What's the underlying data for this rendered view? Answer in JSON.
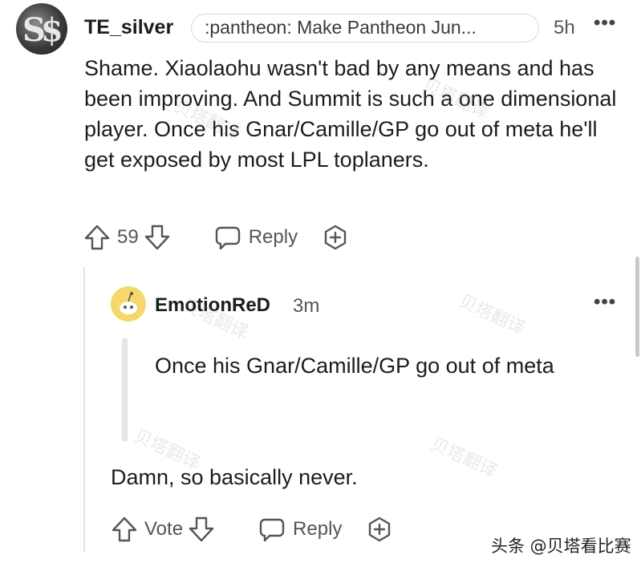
{
  "post_comment": {
    "username": "TE_silver",
    "flair": ":pantheon: Make Pantheon Jun...",
    "time": "5h",
    "more_icon": "more-dots-icon",
    "body": "Shame. Xiaolaohu wasn't bad by any means and has been improving. And Summit is such a one dimensional player. Once his Gnar/Camille/GP go out of meta he'll get exposed by most LPL toplaners.",
    "vote_count": "59",
    "reply_label": "Reply",
    "icons": [
      "upvote-icon",
      "downvote-icon",
      "reply-bubble-icon",
      "award-icon"
    ]
  },
  "reply_comment": {
    "username": "EmotionReD",
    "time": "3m",
    "quote": "Once his Gnar/Camille/GP go out of meta",
    "body": "Damn, so basically never.",
    "vote_label": "Vote",
    "reply_label": "Reply",
    "avatar_color": "#f6d76b"
  },
  "watermark": "贝塔翻译",
  "source_label": "头条 @贝塔看比赛"
}
